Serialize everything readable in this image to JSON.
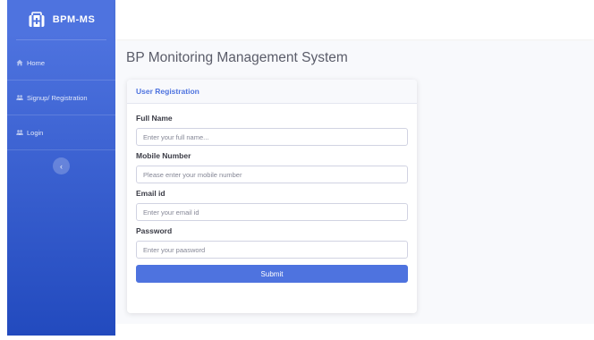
{
  "sidebar": {
    "brand_text": "BPM-MS",
    "brand_icon": "medical-kit-icon",
    "items": [
      {
        "label": "Home",
        "icon": "home-icon"
      },
      {
        "label": "Signup/ Registration",
        "icon": "users-icon"
      },
      {
        "label": "Login",
        "icon": "users-icon"
      }
    ],
    "toggle_icon": "chevron-left-icon",
    "toggle_glyph": "‹"
  },
  "main": {
    "page_title": "BP Monitoring Management System"
  },
  "form": {
    "header": "User Registration",
    "fields": [
      {
        "label": "Full Name",
        "placeholder": "Enter your full name...",
        "value": ""
      },
      {
        "label": "Mobile Number",
        "placeholder": "Please enter your mobile number",
        "value": ""
      },
      {
        "label": "Email id",
        "placeholder": "Enter your email id",
        "value": ""
      },
      {
        "label": "Password",
        "placeholder": "Enter your paasword",
        "value": ""
      }
    ],
    "submit_label": "Submit"
  },
  "colors": {
    "primary": "#4e73df",
    "sidebar_gradient_end": "#224abe",
    "page_background": "#f8f9fc",
    "text_dark": "#5a5c69"
  }
}
